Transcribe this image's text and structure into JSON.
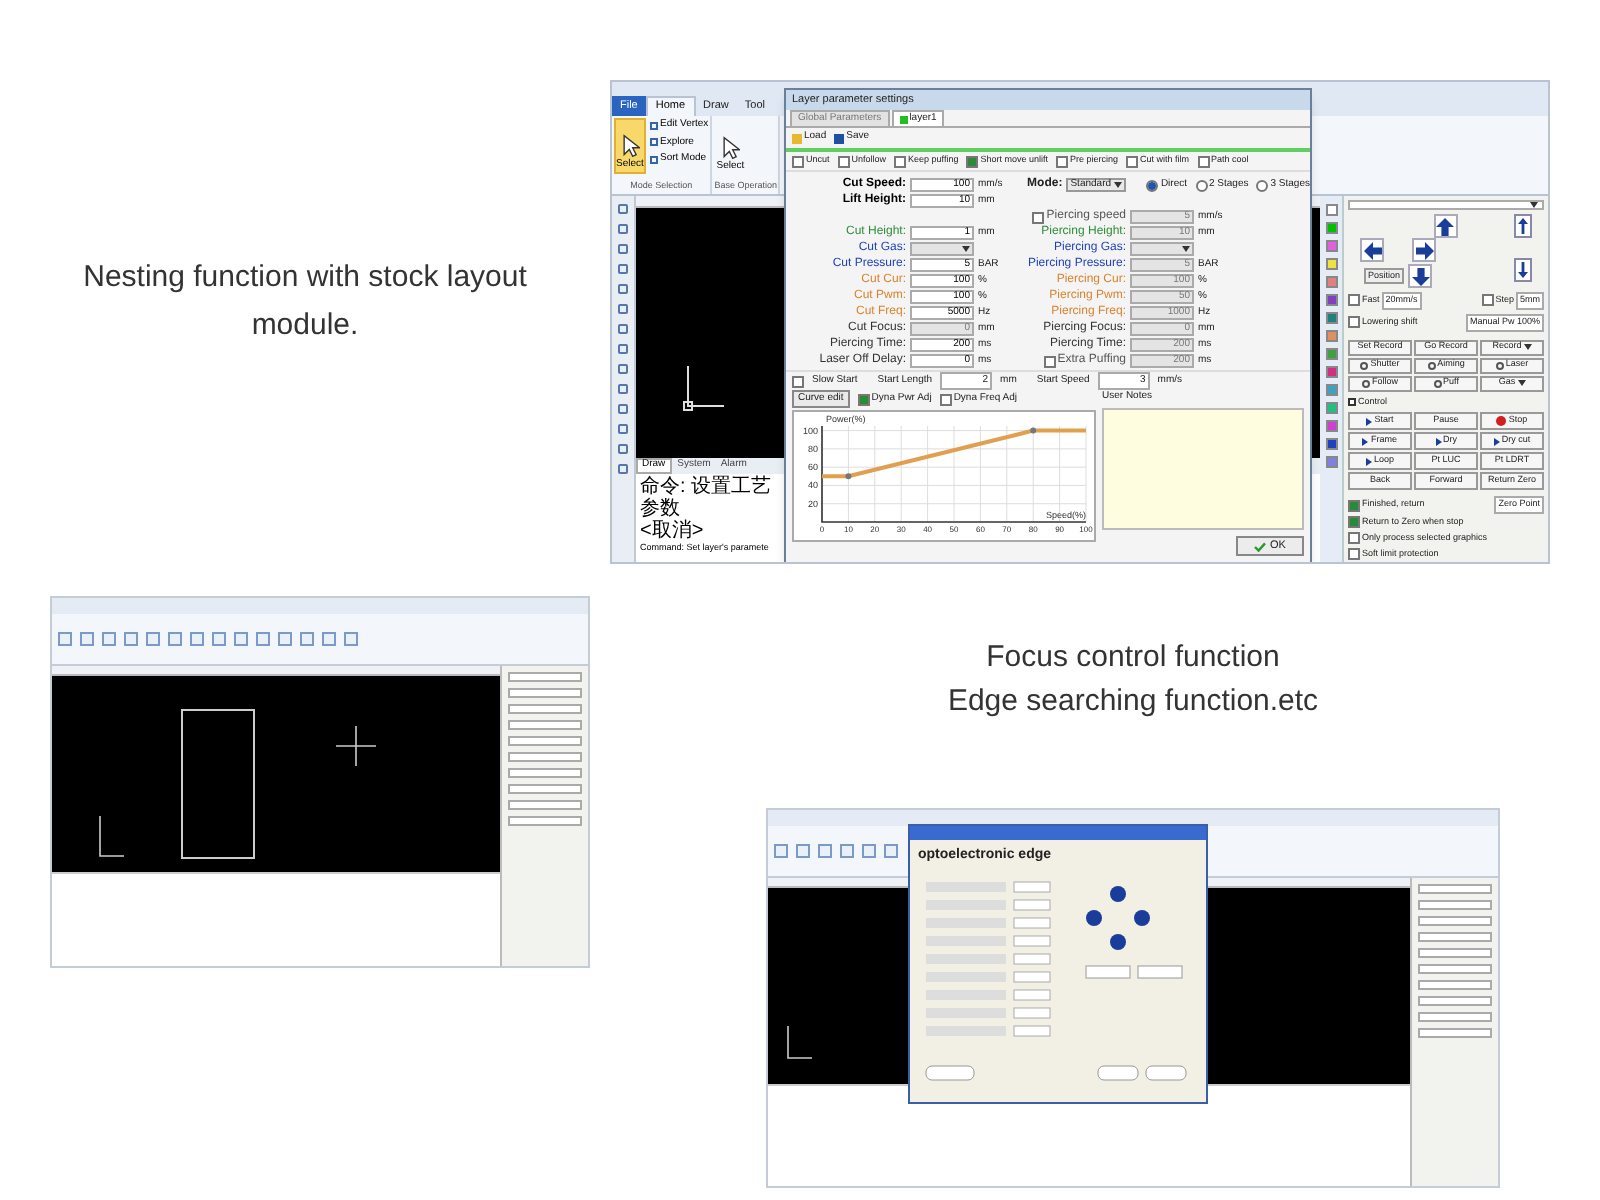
{
  "caption_nesting": "Nesting function with stock layout module.",
  "caption_focus": [
    "Focus control function",
    "Edge searching function.etc"
  ],
  "nesting_screenshot": {
    "ribbon_tabs": [
      {
        "label": "File",
        "selected": false
      },
      {
        "label": "Home",
        "selected": true
      },
      {
        "label": "Draw",
        "selected": false
      },
      {
        "label": "Tool",
        "selected": false
      }
    ],
    "ribbon_groups": [
      {
        "title": "Mode Selection",
        "big": "Select",
        "items": [
          "Edit Vertex",
          "Explore",
          "Sort Mode"
        ]
      },
      {
        "title": "Base Operation",
        "big": "Select"
      }
    ],
    "bottom_tabs": [
      {
        "label": "Draw",
        "selected": true
      },
      {
        "label": "System",
        "selected": false
      },
      {
        "label": "Alarm",
        "selected": false
      }
    ],
    "command_lines": [
      "命令: 设置工艺参数",
      "<取消>",
      "Command: Set layer's paramete"
    ],
    "dialog": {
      "title": "Layer parameter settings",
      "tabs": [
        {
          "label": "Global Parameters",
          "selected": false
        },
        {
          "label": "layer1",
          "selected": true
        }
      ],
      "toolbar": [
        "Load",
        "Save"
      ],
      "options": [
        {
          "label": "Uncut",
          "checked": false
        },
        {
          "label": "Unfollow",
          "checked": false
        },
        {
          "label": "Keep puffing",
          "checked": false
        },
        {
          "label": "Short move unlift",
          "checked": true
        },
        {
          "label": "Pre piercing",
          "checked": false
        },
        {
          "label": "Cut with film",
          "checked": false
        },
        {
          "label": "Path cool",
          "checked": false
        }
      ],
      "mode": {
        "label": "Mode:",
        "value": "Standard"
      },
      "stages": [
        {
          "label": "Direct",
          "selected": true
        },
        {
          "label": "2 Stages",
          "selected": false
        },
        {
          "label": "3 Stages",
          "selected": false
        }
      ],
      "rows": [
        {
          "left": {
            "kind": "field",
            "label": "Cut Speed:",
            "value": "100",
            "unit": "mm/s",
            "color": "#000000",
            "disabled": false
          }
        },
        {
          "left": {
            "kind": "field",
            "label": "Lift Height:",
            "value": "10",
            "unit": "mm",
            "color": "#000000",
            "disabled": false
          }
        },
        {
          "right": {
            "kind": "check_field",
            "label": "Piercing speed",
            "checked": false,
            "value": "5",
            "unit": "mm/s",
            "color": "#555555",
            "disabled": true
          }
        },
        {
          "left": {
            "kind": "field",
            "label": "Cut Height:",
            "value": "1",
            "unit": "mm",
            "color": "#2e8b3a",
            "disabled": false
          },
          "right": {
            "kind": "field",
            "label": "Piercing Height:",
            "value": "10",
            "unit": "mm",
            "color": "#2e8b3a",
            "disabled": true
          }
        },
        {
          "left": {
            "kind": "select",
            "label": "Cut Gas:",
            "color": "#1f3fbf",
            "disabled": true
          },
          "right": {
            "kind": "select",
            "label": "Piercing Gas:",
            "color": "#1f3fbf",
            "disabled": true
          }
        },
        {
          "left": {
            "kind": "field",
            "label": "Cut Pressure:",
            "value": "5",
            "unit": "BAR",
            "color": "#1f3fbf",
            "disabled": false
          },
          "right": {
            "kind": "field",
            "label": "Piercing Pressure:",
            "value": "5",
            "unit": "BAR",
            "color": "#1f3fbf",
            "disabled": true
          }
        },
        {
          "left": {
            "kind": "field",
            "label": "Cut Cur:",
            "value": "100",
            "unit": "%",
            "color": "#d9822b",
            "disabled": false
          },
          "right": {
            "kind": "field",
            "label": "Piercing Cur:",
            "value": "100",
            "unit": "%",
            "color": "#d9822b",
            "disabled": true
          }
        },
        {
          "left": {
            "kind": "field",
            "label": "Cut Pwm:",
            "value": "100",
            "unit": "%",
            "color": "#d9822b",
            "disabled": false
          },
          "right": {
            "kind": "field",
            "label": "Piercing Pwm:",
            "value": "50",
            "unit": "%",
            "color": "#d9822b",
            "disabled": true
          }
        },
        {
          "left": {
            "kind": "field",
            "label": "Cut Freq:",
            "value": "5000",
            "unit": "Hz",
            "color": "#d9822b",
            "disabled": false
          },
          "right": {
            "kind": "field",
            "label": "Piercing Freq:",
            "value": "1000",
            "unit": "Hz",
            "color": "#d9822b",
            "disabled": true
          }
        },
        {
          "left": {
            "kind": "field",
            "label": "Cut Focus:",
            "value": "0",
            "unit": "mm",
            "color": "#333333",
            "disabled": true
          },
          "right": {
            "kind": "field",
            "label": "Piercing Focus:",
            "value": "0",
            "unit": "mm",
            "color": "#333333",
            "disabled": true
          }
        },
        {
          "left": {
            "kind": "field",
            "label": "Piercing Time:",
            "value": "200",
            "unit": "ms",
            "color": "#333333",
            "disabled": false
          },
          "right": {
            "kind": "field",
            "label": "Piercing Time:",
            "value": "200",
            "unit": "ms",
            "color": "#333333",
            "disabled": true
          }
        },
        {
          "left": {
            "kind": "field",
            "label": "Laser Off Delay:",
            "value": "0",
            "unit": "ms",
            "color": "#333333",
            "disabled": false
          },
          "right": {
            "kind": "check_field",
            "label": "Extra Puffing",
            "checked": false,
            "value": "200",
            "unit": "ms",
            "color": "#555555",
            "disabled": true
          }
        }
      ],
      "slow_start": {
        "label": "Slow Start",
        "checked": false,
        "length_label": "Start Length",
        "length": "2",
        "length_unit": "mm",
        "speed_label": "Start Speed",
        "speed": "3",
        "speed_unit": "mm/s"
      },
      "curve_button": "Curve edit",
      "curve_options": [
        {
          "label": "Dyna Pwr Adj",
          "checked": true
        },
        {
          "label": "Dyna Freq Adj",
          "checked": false
        }
      ],
      "chart_data": {
        "type": "line",
        "xlabel": "Speed(%)",
        "ylabel": "Power(%)",
        "x": [
          0,
          10,
          80,
          100
        ],
        "series": [
          {
            "color": "#e0a050",
            "values": [
              50,
              50,
              100,
              100
            ]
          }
        ],
        "xlim": [
          0,
          100
        ],
        "ylim": [
          0,
          105
        ],
        "xticks": [
          0,
          10,
          20,
          30,
          40,
          50,
          60,
          70,
          80,
          90,
          100
        ],
        "yticks": [
          20,
          40,
          60,
          80,
          100
        ],
        "grid": true
      },
      "notes_label": "User Notes",
      "ok": "OK"
    },
    "layers": [
      {
        "color": "#ffffff"
      },
      {
        "color": "#00c000"
      },
      {
        "color": "#e060e0"
      },
      {
        "color": "#f0e040"
      },
      {
        "color": "#e08080"
      },
      {
        "color": "#8040c0"
      },
      {
        "color": "#208080"
      },
      {
        "color": "#e09060"
      },
      {
        "color": "#40a040"
      },
      {
        "color": "#d03080"
      },
      {
        "color": "#40a0c0"
      },
      {
        "color": "#20c080"
      },
      {
        "color": "#d040d0"
      },
      {
        "color": "#2040c0"
      },
      {
        "color": "#8080e0"
      }
    ],
    "panel": {
      "position": "Position",
      "jog_options": [
        {
          "label": "Fast",
          "checked": false,
          "value": "20mm/s"
        },
        {
          "label": "Step",
          "checked": false,
          "value": "5mm"
        }
      ],
      "lowering": {
        "label": "Lowering shift",
        "checked": false
      },
      "manual": "Manual Pw 100%",
      "buttons": [
        {
          "label": "Set Record",
          "kind": "plain"
        },
        {
          "label": "Go Record",
          "kind": "plain"
        },
        {
          "label": "Record",
          "kind": "menu"
        },
        {
          "label": "Shutter",
          "kind": "toggle"
        },
        {
          "label": "Aiming",
          "kind": "toggle"
        },
        {
          "label": "Laser",
          "kind": "toggle"
        },
        {
          "label": "Follow",
          "kind": "toggle"
        },
        {
          "label": "Puff",
          "kind": "toggle"
        },
        {
          "label": "Gas",
          "kind": "menu"
        }
      ],
      "control_label": "Control",
      "control_buttons": [
        {
          "label": "Start",
          "kind": "play"
        },
        {
          "label": "Pause",
          "kind": "plain"
        },
        {
          "label": "Stop",
          "kind": "stop"
        },
        {
          "label": "Frame",
          "kind": "play"
        },
        {
          "label": "Dry",
          "kind": "play"
        },
        {
          "label": "Dry cut",
          "kind": "play"
        },
        {
          "label": "Loop",
          "kind": "play"
        },
        {
          "label": "Pt LUC",
          "kind": "plain"
        },
        {
          "label": "Pt LDRT",
          "kind": "plain"
        },
        {
          "label": "Back",
          "kind": "plain"
        },
        {
          "label": "Forward",
          "kind": "plain"
        },
        {
          "label": "Return Zero",
          "kind": "plain"
        }
      ],
      "finish_options": [
        {
          "label": "Finished, return",
          "checked": true
        },
        {
          "label": "Return to Zero when stop",
          "checked": true
        },
        {
          "label": "Only process selected graphics",
          "checked": false
        },
        {
          "label": "Soft limit protection",
          "checked": false
        }
      ],
      "finish_target": "Zero Point"
    }
  },
  "edge_screenshot": {
    "heading": "optoelectronic edge"
  }
}
